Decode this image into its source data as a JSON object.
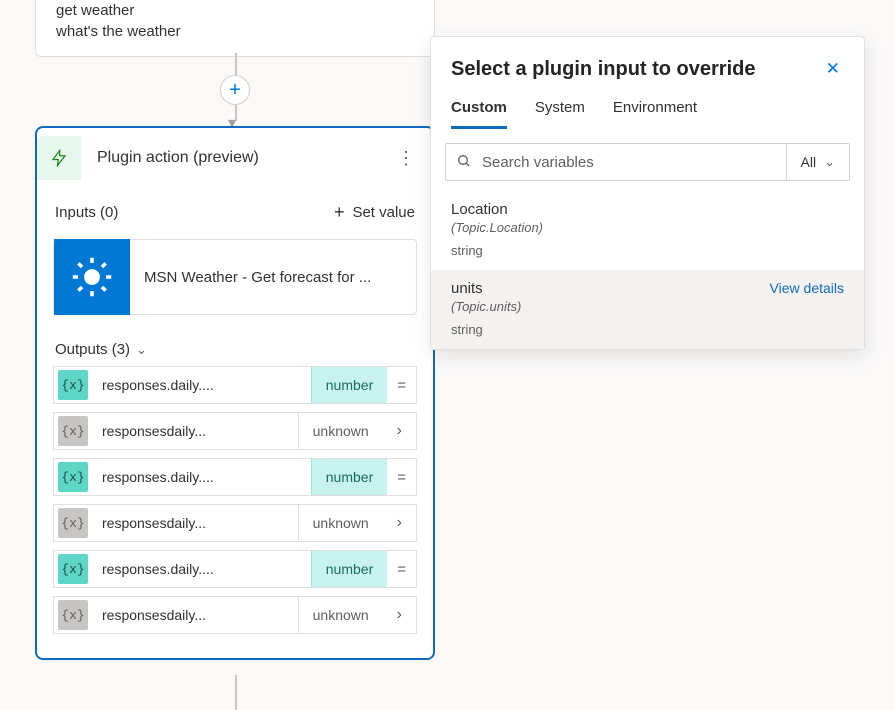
{
  "trigger": {
    "phrases": [
      "get weather",
      "what's the weather"
    ]
  },
  "plugin": {
    "title": "Plugin action (preview)",
    "inputs_label": "Inputs (0)",
    "set_value_label": "Set value",
    "item_label": "MSN Weather - Get forecast for ...",
    "outputs_label": "Outputs (3)",
    "outputs": [
      {
        "badge": "{x}",
        "badgeStyle": "teal",
        "name": "responses.daily....",
        "type": "number",
        "typeStyle": "teal",
        "trail": "eq"
      },
      {
        "badge": "{x}",
        "badgeStyle": "gray",
        "name": "responsesdaily...",
        "type": "unknown",
        "typeStyle": "plain",
        "trail": "chev"
      },
      {
        "badge": "{x}",
        "badgeStyle": "teal",
        "name": "responses.daily....",
        "type": "number",
        "typeStyle": "teal",
        "trail": "eq"
      },
      {
        "badge": "{x}",
        "badgeStyle": "gray",
        "name": "responsesdaily...",
        "type": "unknown",
        "typeStyle": "plain",
        "trail": "chev"
      },
      {
        "badge": "{x}",
        "badgeStyle": "teal",
        "name": "responses.daily....",
        "type": "number",
        "typeStyle": "teal",
        "trail": "eq"
      },
      {
        "badge": "{x}",
        "badgeStyle": "gray",
        "name": "responsesdaily...",
        "type": "unknown",
        "typeStyle": "plain",
        "trail": "chev"
      }
    ]
  },
  "panel": {
    "title": "Select a plugin input to override",
    "tabs": [
      "Custom",
      "System",
      "Environment"
    ],
    "active_tab": 0,
    "search_placeholder": "Search variables",
    "filter_label": "All",
    "view_details_label": "View details",
    "variables": [
      {
        "name": "Location",
        "path": "(Topic.Location)",
        "type": "string",
        "selected": false
      },
      {
        "name": "units",
        "path": "(Topic.units)",
        "type": "string",
        "selected": true
      }
    ]
  },
  "glyphs": {
    "badge_var": "{x}",
    "eq": "=",
    "chev_right": "›",
    "chev_down": "⌄",
    "plus": "+",
    "close": "✕"
  }
}
